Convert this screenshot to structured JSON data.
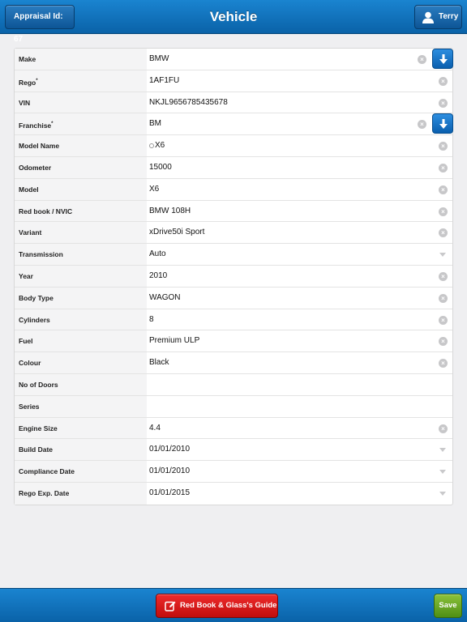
{
  "header": {
    "title": "Vehicle",
    "back_label": "Appraisal Id: 67",
    "user_label": "Terry"
  },
  "fields": [
    {
      "label": "Make",
      "value": "BMW",
      "control": "dropdown"
    },
    {
      "label": "Rego",
      "required": true,
      "value": "1AF1FU",
      "control": "clear"
    },
    {
      "label": "VIN",
      "value": "NKJL9656785435678",
      "control": "clear"
    },
    {
      "label": "Franchise",
      "required": true,
      "value": "BM",
      "control": "dropdown"
    },
    {
      "label": "Model Name",
      "value": "X6",
      "control": "clear",
      "search": true
    },
    {
      "label": "Odometer",
      "value": "15000",
      "control": "clear"
    },
    {
      "label": "Model",
      "value": "X6",
      "control": "clear"
    },
    {
      "label": "Red book / NVIC",
      "value": "BMW 108H",
      "control": "clear"
    },
    {
      "label": "Variant",
      "value": "xDrive50i Sport",
      "control": "clear"
    },
    {
      "label": "Transmission",
      "value": "Auto",
      "control": "caret"
    },
    {
      "label": "Year",
      "value": "2010",
      "control": "clear"
    },
    {
      "label": "Body Type",
      "value": "WAGON",
      "control": "clear"
    },
    {
      "label": "Cylinders",
      "value": "8",
      "control": "clear"
    },
    {
      "label": "Fuel",
      "value": "Premium ULP",
      "control": "clear"
    },
    {
      "label": "Colour",
      "value": "Black",
      "control": "clear"
    },
    {
      "label": "No of Doors",
      "value": "",
      "control": "none"
    },
    {
      "label": "Series",
      "value": "",
      "control": "none"
    },
    {
      "label": "Engine Size",
      "value": "4.4",
      "control": "clear"
    },
    {
      "label": "Build Date",
      "value": "01/01/2010",
      "control": "caret"
    },
    {
      "label": "Compliance Date",
      "value": "01/01/2010",
      "control": "caret"
    },
    {
      "label": "Rego Exp. Date",
      "value": "01/01/2015",
      "control": "caret"
    }
  ],
  "footer": {
    "redbook_label": "Red Book & Glass's Guide",
    "save_label": "Save"
  },
  "colors": {
    "primary_blue": "#0a62a8",
    "redbook_red": "#c10d0d",
    "save_green": "#4f8f14"
  }
}
